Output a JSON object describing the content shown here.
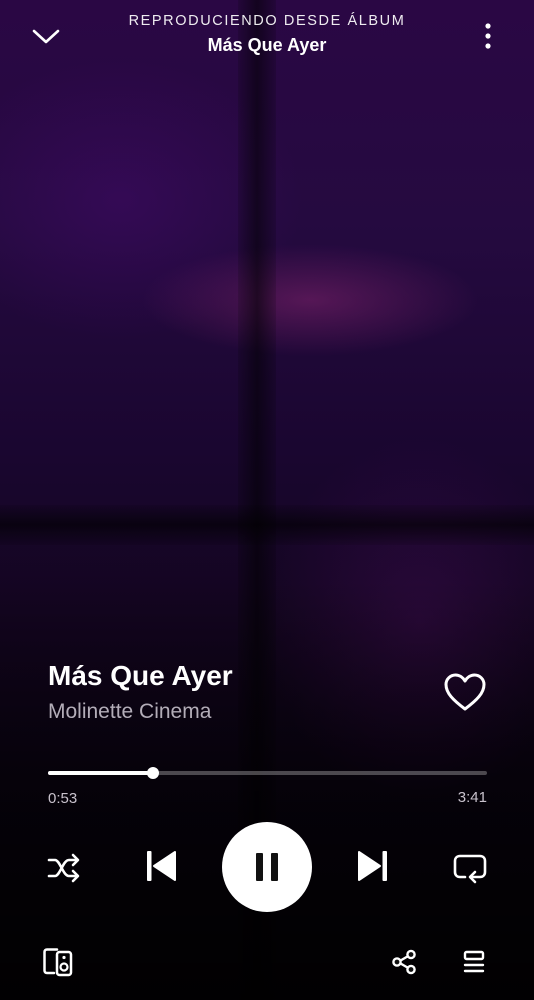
{
  "header": {
    "context_label": "REPRODUCIENDO DESDE ÁLBUM",
    "context_title": "Más Que Ayer"
  },
  "track": {
    "title": "Más Que Ayer",
    "artist": "Molinette Cinema",
    "liked": false
  },
  "playback": {
    "elapsed": "0:53",
    "total": "3:41",
    "progress_fraction": 0.24,
    "state": "playing"
  },
  "icons": {
    "collapse": "chevron-down-icon",
    "more": "more-vertical-icon",
    "like": "heart-outline-icon",
    "shuffle": "shuffle-icon",
    "previous": "skip-previous-icon",
    "pause": "pause-icon",
    "next": "skip-next-icon",
    "repeat": "repeat-icon",
    "devices": "devices-icon",
    "share": "share-icon",
    "queue": "queue-icon"
  },
  "colors": {
    "accent": "#ffffff",
    "secondary_text": "#b3adb8",
    "background_top": "#2a0744"
  }
}
